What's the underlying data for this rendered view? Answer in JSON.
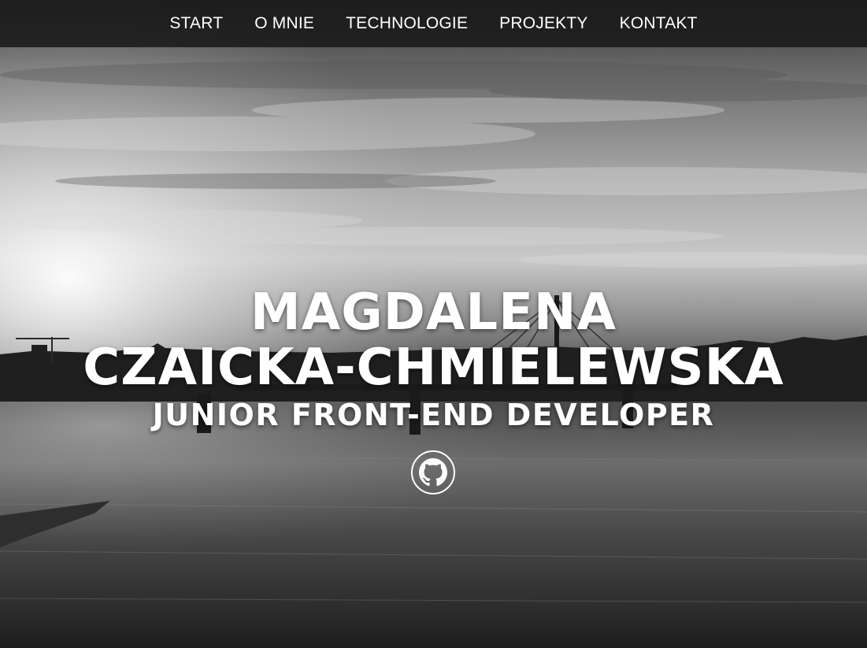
{
  "nav": {
    "items": [
      {
        "label": "START"
      },
      {
        "label": "O MNIE"
      },
      {
        "label": "TECHNOLOGIE"
      },
      {
        "label": "PROJEKTY"
      },
      {
        "label": "KONTAKT"
      }
    ]
  },
  "hero": {
    "name_line1": "MAGDALENA",
    "name_line2": "CZAICKA-CHMIELEWSKA",
    "role": "JUNIOR FRONT-END DEVELOPER",
    "social_icon": "github-icon"
  },
  "colors": {
    "nav_background": "#191919",
    "text": "#ffffff"
  }
}
